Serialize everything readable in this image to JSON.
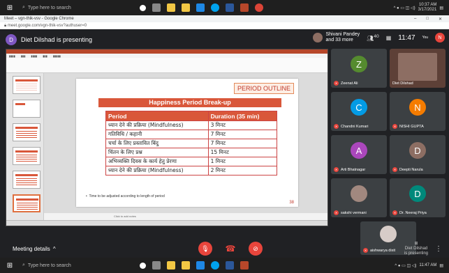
{
  "taskbar_top": {
    "search_placeholder": "Type here to search",
    "time": "10:37 AM",
    "date": "3/17/2021"
  },
  "chrome": {
    "window_title": "Meet – vgn-thik-vsv - Google Chrome",
    "url": "meet.google.com/vgn-thik-vsv?authuser=0"
  },
  "meet": {
    "presenter_initial": "D",
    "presenter_label": "Diet Dilshad is presenting",
    "people_name": "Shivani Pandey",
    "people_more": "and 33 more",
    "people_count": "40",
    "time": "11:47",
    "you_label": "You",
    "you_initial": "N"
  },
  "slide": {
    "badge": "PERIOD OUTLINE",
    "heading": "Happiness Period Break-up",
    "table_headers": [
      "Period",
      "Duration (35 min)"
    ],
    "rows": [
      [
        "ध्यान देने की प्रक्रिया (Mindfulness)",
        "3 मिनट"
      ],
      [
        "गतिविधि / कहानी",
        "7 मिनट"
      ],
      [
        "चर्चा के लिए प्रस्तावित बिंदु",
        "7 मिनट"
      ],
      [
        "चिंतन के लिए प्रश्न",
        "15 मिनट"
      ],
      [
        "अभिव्यक्ति दिवस के कार्य हेतु प्रेरणा",
        "1 मिनट"
      ],
      [
        "ध्यान देने की प्रक्रिया (Mindfulness)",
        "2 मिनट"
      ]
    ],
    "note": "Time to be adjusted according to length of period",
    "number": "38",
    "notes_placeholder": "Click to add notes"
  },
  "participants": [
    {
      "name": "Zeenat Ali",
      "initial": "Z",
      "color": "#558b2f"
    },
    {
      "name": "Diet Dilshad",
      "initial": "",
      "color": ""
    },
    {
      "name": "Chandni Kumari",
      "initial": "C",
      "color": "#039be5"
    },
    {
      "name": "NISHI GUPTA",
      "initial": "N",
      "color": "#f57c00"
    },
    {
      "name": "Arti Bhatnagar",
      "initial": "A",
      "color": "#ab47bc"
    },
    {
      "name": "Deepti Narula",
      "initial": "D",
      "color": "#8d6e63"
    },
    {
      "name": "sakshi vermani",
      "initial": "",
      "color": ""
    },
    {
      "name": "Dr. Neeraj Priya",
      "initial": "D",
      "color": "#00897b"
    },
    {
      "name": "aishwarya dixit",
      "initial": "",
      "color": ""
    }
  ],
  "bottom": {
    "meeting_details": "Meeting details",
    "presenting_note_1": "Diet Dilshad",
    "presenting_note_2": "is presenting"
  },
  "taskbar_bottom": {
    "search_placeholder": "Type here to search",
    "time": "11:47 AM"
  }
}
